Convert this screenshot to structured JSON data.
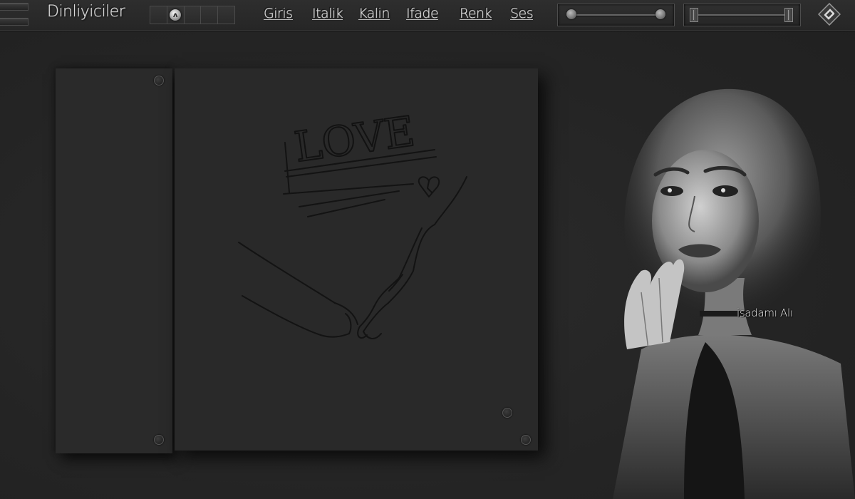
{
  "header": {
    "title": "Dinliyiciler",
    "segment_knob_glyph": "ʌ",
    "nav": [
      "Giris",
      "Italik",
      "Kalin",
      "Ifade",
      "Renk",
      "Ses"
    ]
  },
  "sliders": {
    "left_slider": {
      "min_value": 0,
      "max_value": 100
    },
    "right_slider": {
      "min_value": 0,
      "max_value": 100
    }
  },
  "content": {
    "sketch_word": "LOVE",
    "watermark": "isadamı Alı"
  },
  "colors": {
    "background": "#262626",
    "text": "#d8d8d8",
    "panel": "#292929"
  },
  "icons": {
    "menu": "menu-icon",
    "logo": "logo-icon",
    "knob": "knob-icon"
  }
}
